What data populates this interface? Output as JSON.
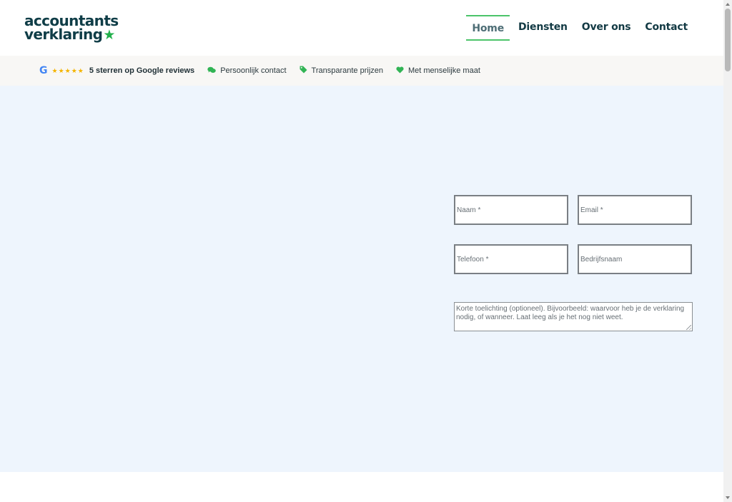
{
  "logo": {
    "line1": "accountants",
    "line2": "verklaring",
    "star": "★"
  },
  "nav": {
    "items": [
      {
        "label": "Home",
        "active": true
      },
      {
        "label": "Diensten",
        "active": false
      },
      {
        "label": "Over ons",
        "active": false
      },
      {
        "label": "Contact",
        "active": false
      }
    ]
  },
  "trustbar": {
    "google_icon": "G",
    "stars": "★★★★★",
    "reviews": "5 sterren op Google reviews",
    "contact_icon": "chat-icon",
    "contact": "Persoonlijk contact",
    "prices_icon": "tag-icon",
    "prices": "Transparante prijzen",
    "heart_icon": "heart-icon",
    "human": "Met menselijke maat"
  },
  "form": {
    "name_placeholder": "Naam *",
    "email_placeholder": "Email *",
    "phone_placeholder": "Telefoon *",
    "company_placeholder": "Bedrijfsnaam",
    "notes_placeholder": "Korte toelichting (optioneel). Bijvoorbeeld: waarvoor heb je de verklaring nodig, of wanneer. Laat leeg als je het nog niet weet."
  },
  "colors": {
    "brand_dark": "#0f3d47",
    "brand_green": "#22b04b",
    "hero_bg": "#eef5fd",
    "trustbar_bg": "#f8f7f5"
  }
}
